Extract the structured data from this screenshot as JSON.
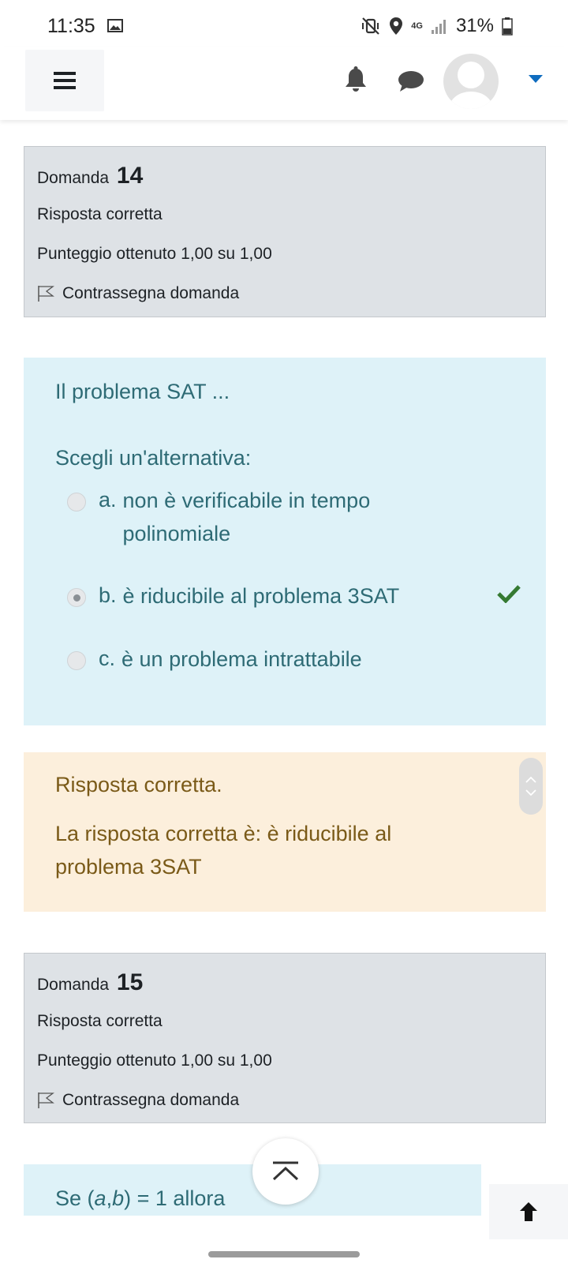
{
  "status": {
    "time": "11:35",
    "network": "4G",
    "battery": "31%"
  },
  "questions": [
    {
      "label": "Domanda",
      "number": "14",
      "state": "Risposta corretta",
      "grade": "Punteggio ottenuto 1,00 su 1,00",
      "flag_label": "Contrassegna domanda"
    },
    {
      "label": "Domanda",
      "number": "15",
      "state": "Risposta corretta",
      "grade": "Punteggio ottenuto 1,00 su 1,00",
      "flag_label": "Contrassegna domanda"
    }
  ],
  "q14": {
    "text": "Il problema SAT ...",
    "prompt": "Scegli un'alternativa:",
    "options": [
      {
        "num": "a.",
        "text": "non è verificabile in tempo polinomiale",
        "selected": false
      },
      {
        "num": "b.",
        "text": "è riducibile al problema 3SAT",
        "selected": true,
        "correct": true
      },
      {
        "num": "c.",
        "text": "è un problema intrattabile",
        "selected": false
      }
    ],
    "feedback_state": "Risposta corretta.",
    "feedback_right": "La risposta corretta è: è riducibile al problema 3SAT"
  },
  "q15": {
    "text_prefix": "Se (",
    "text_a": "a",
    "text_comma": ",",
    "text_b": "b",
    "text_suffix": ") = 1 allora"
  },
  "colors": {
    "info_bg": "#dee2e6",
    "formulation_bg": "#def2f8",
    "feedback_bg": "#fcefdc",
    "correct_green": "#357a32",
    "accent_blue": "#0f6cbf"
  }
}
